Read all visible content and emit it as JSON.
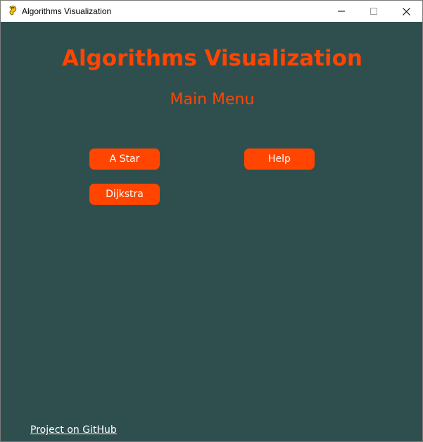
{
  "window": {
    "title": "Algorithms Visualization",
    "icon": "pygame-snake-icon",
    "controls": {
      "minimize_icon": "minimize-icon",
      "maximize_icon": "maximize-icon",
      "close_icon": "close-icon"
    }
  },
  "main": {
    "title": "Algorithms Visualization",
    "subtitle": "Main Menu",
    "buttons": {
      "astar": "A Star",
      "help": "Help",
      "dijkstra": "Dijkstra"
    },
    "footer_link": "Project on GitHub"
  },
  "colors": {
    "background": "#2f4f4f",
    "accent": "#ff4500",
    "button_text": "#ffffff",
    "link_text": "#ffffff"
  }
}
